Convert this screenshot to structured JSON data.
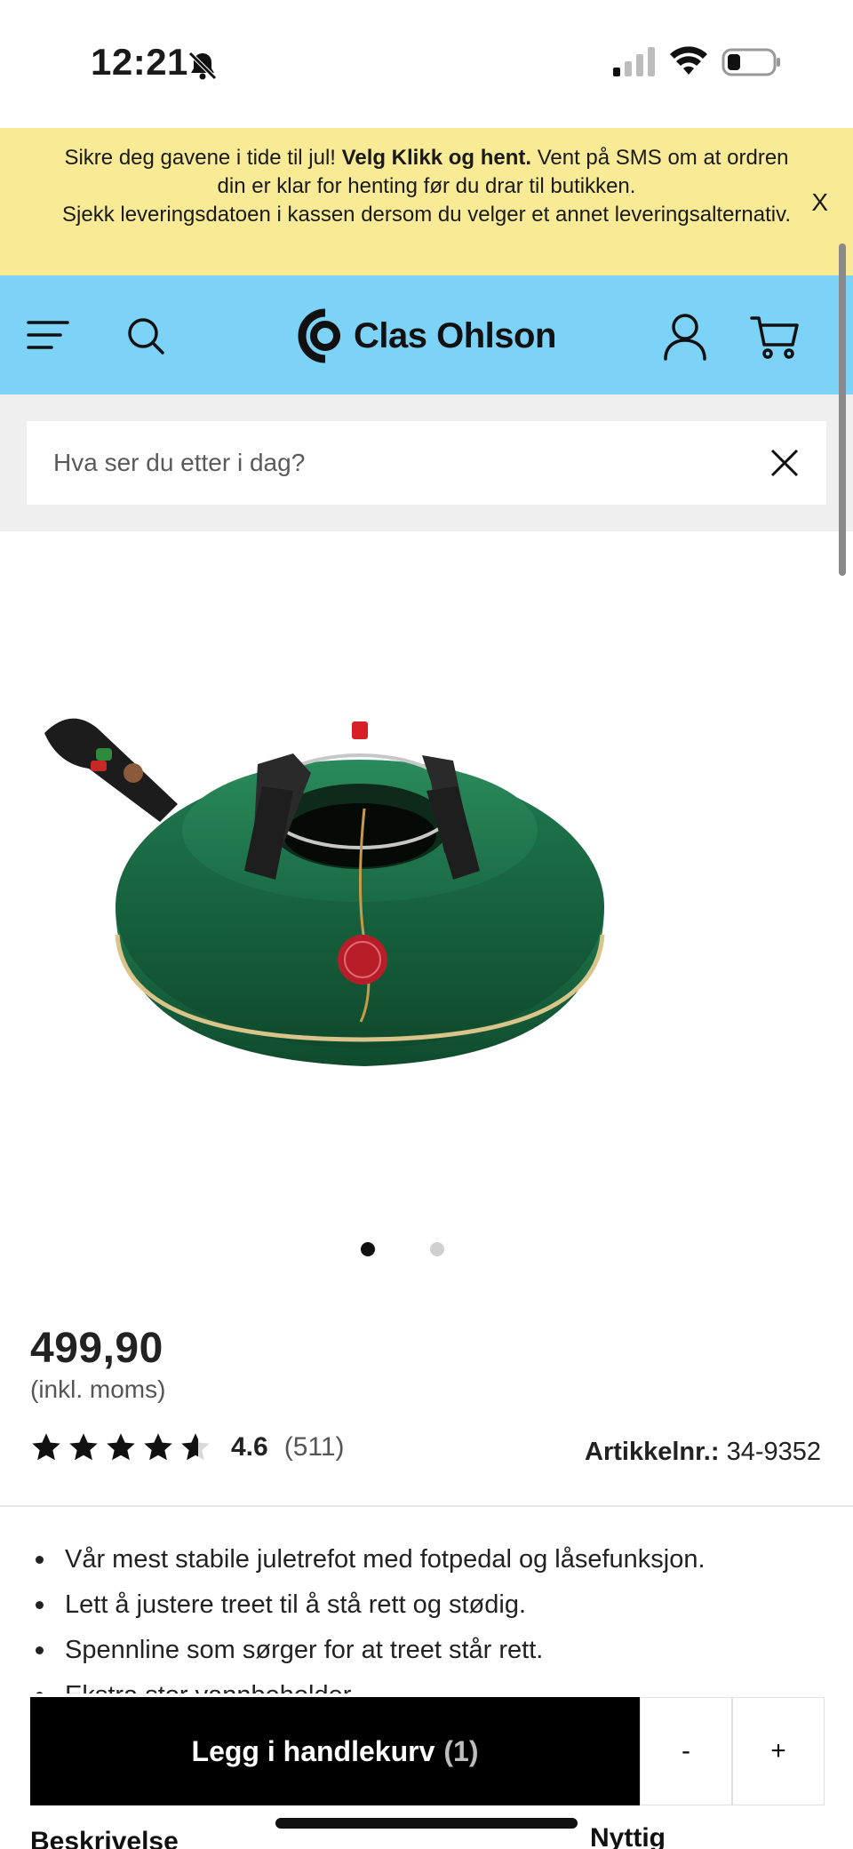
{
  "status_bar": {
    "time": "12:21",
    "icons": [
      "bell-off-icon",
      "cellular-signal-icon",
      "wifi-icon",
      "battery-icon"
    ]
  },
  "announcement": {
    "line1_pre": "Sikre deg gavene i tide til jul! ",
    "line1_bold": "Velg Klikk og hent.",
    "line1_post": " Vent på SMS om at ordren din er klar for henting før du drar til butikken.",
    "line2": "Sjekk leveringsdatoen i kassen dersom du velger et annet leveringsalternativ.",
    "close_label": "X"
  },
  "header": {
    "brand": "Clas Ohlson",
    "icons": [
      "menu-icon",
      "search-icon",
      "user-icon",
      "cart-icon"
    ]
  },
  "search": {
    "placeholder": "Hva ser du etter i dag?"
  },
  "product": {
    "image_alt": "Grønn juletrefot med fotpedal",
    "carousel": {
      "current": 1,
      "total": 2
    },
    "price": "499,90",
    "vat_note": "(inkl. moms)",
    "rating": {
      "value": "4.6",
      "count": "(511)",
      "stars": 4.6,
      "max_stars": 5
    },
    "sku_label": "Artikkelnr.:",
    "sku_value": "34-9352",
    "bullets": [
      "Vår mest stabile juletrefot med fotpedal og låsefunksjon.",
      "Lett å justere treet til å stå rett og stødig.",
      "Spennline som sørger for at treet står rett.",
      "Ekstra stor vannbeholder"
    ]
  },
  "cart_bar": {
    "add_label": "Legg i handlekurv",
    "quantity_label": "(1)",
    "minus_label": "-",
    "plus_label": "+"
  },
  "below": {
    "left_label": "Beskrivelse",
    "right_label": "Nyttig"
  },
  "colors": {
    "announcement_bg": "#f9ea95",
    "header_bg": "#7dd3f7",
    "button_bg": "#000000",
    "stand_green": "#1e6b45"
  }
}
